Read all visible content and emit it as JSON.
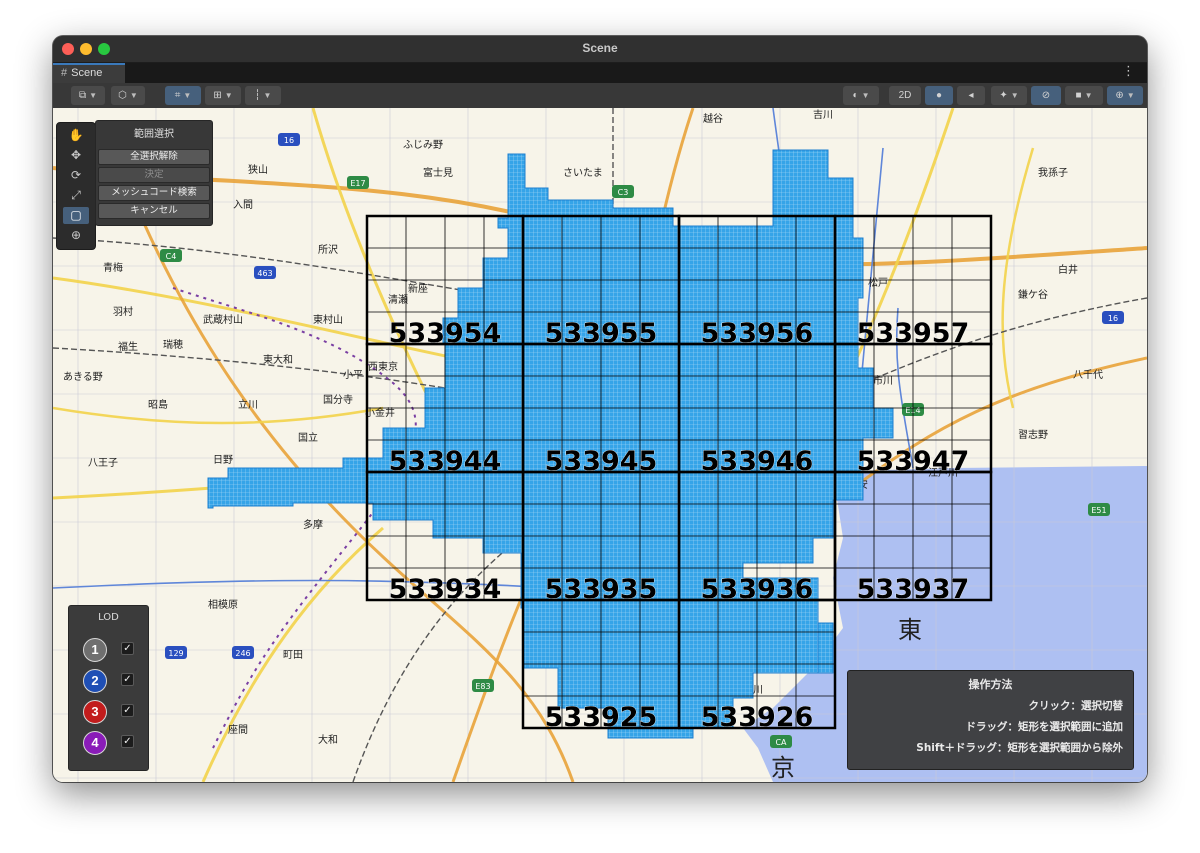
{
  "window": {
    "title": "Scene"
  },
  "tab": {
    "label": "Scene",
    "glyph": "#"
  },
  "toolbar": {
    "mode_2d": "2D"
  },
  "tools": [
    {
      "name": "hand-tool",
      "glyph": "✋",
      "active": false
    },
    {
      "name": "move-tool",
      "glyph": "✥",
      "active": false
    },
    {
      "name": "rotate-tool",
      "glyph": "⟳",
      "active": false
    },
    {
      "name": "scale-tool",
      "glyph": "⤢",
      "active": false
    },
    {
      "name": "rect-tool",
      "glyph": "▢",
      "active": true
    },
    {
      "name": "transform-tool",
      "glyph": "⊕",
      "active": false
    }
  ],
  "range_panel": {
    "title": "範囲選択",
    "deselect_all": "全選択解除",
    "confirm": "決定",
    "mesh_search": "メッシュコード検索",
    "cancel": "キャンセル"
  },
  "lod_panel": {
    "title": "LOD",
    "levels": [
      {
        "label": "1",
        "color": "#6f6f6f",
        "checked": true
      },
      {
        "label": "2",
        "color": "#1f4fb5",
        "checked": true
      },
      {
        "label": "3",
        "color": "#c21c1c",
        "checked": true
      },
      {
        "label": "4",
        "color": "#8a1cb8",
        "checked": true
      }
    ]
  },
  "help": {
    "title": "操作方法",
    "line1": "クリック：選択切替",
    "line2": "ドラッグ：矩形を選択範囲に追加",
    "line3": "Shift＋ドラッグ：矩形を選択範囲から除外"
  },
  "mesh_codes": {
    "row1": [
      "533954",
      "533955",
      "533956",
      "533957"
    ],
    "row2": [
      "533944",
      "533945",
      "533946",
      "533947"
    ],
    "row3": [
      "533934",
      "533935",
      "533936",
      "533937"
    ],
    "row4": [
      "533925",
      "533926"
    ]
  },
  "map_labels": {
    "place_names": [
      "ふじみ野",
      "富士見",
      "さいたま",
      "越谷",
      "吉川",
      "狭山",
      "入間",
      "所沢",
      "新座",
      "清瀬",
      "武蔵村山",
      "東村山",
      "東大和",
      "小平",
      "国分寺",
      "昭島",
      "立川",
      "国立",
      "八王子",
      "日野",
      "多摩",
      "相模原",
      "町田",
      "大和",
      "座間",
      "あきる野",
      "羽村",
      "青梅",
      "福生",
      "瑞穂",
      "西東京",
      "小金井",
      "松戸",
      "市川",
      "鎌ケ谷",
      "白井",
      "我孫子",
      "習志野",
      "八千代",
      "浦安",
      "江戸川",
      "多摩川"
    ],
    "large_text": [
      "東",
      "京"
    ],
    "road_shields": [
      "16",
      "E17",
      "C4",
      "463",
      "C3",
      "E14",
      "E51",
      "E83",
      "246",
      "129",
      "CA",
      "16"
    ]
  },
  "colors": {
    "selection_fill": "#35a4e8",
    "grid_line": "#000000",
    "sea": "#aec0f2",
    "land": "#f7f4e9"
  }
}
